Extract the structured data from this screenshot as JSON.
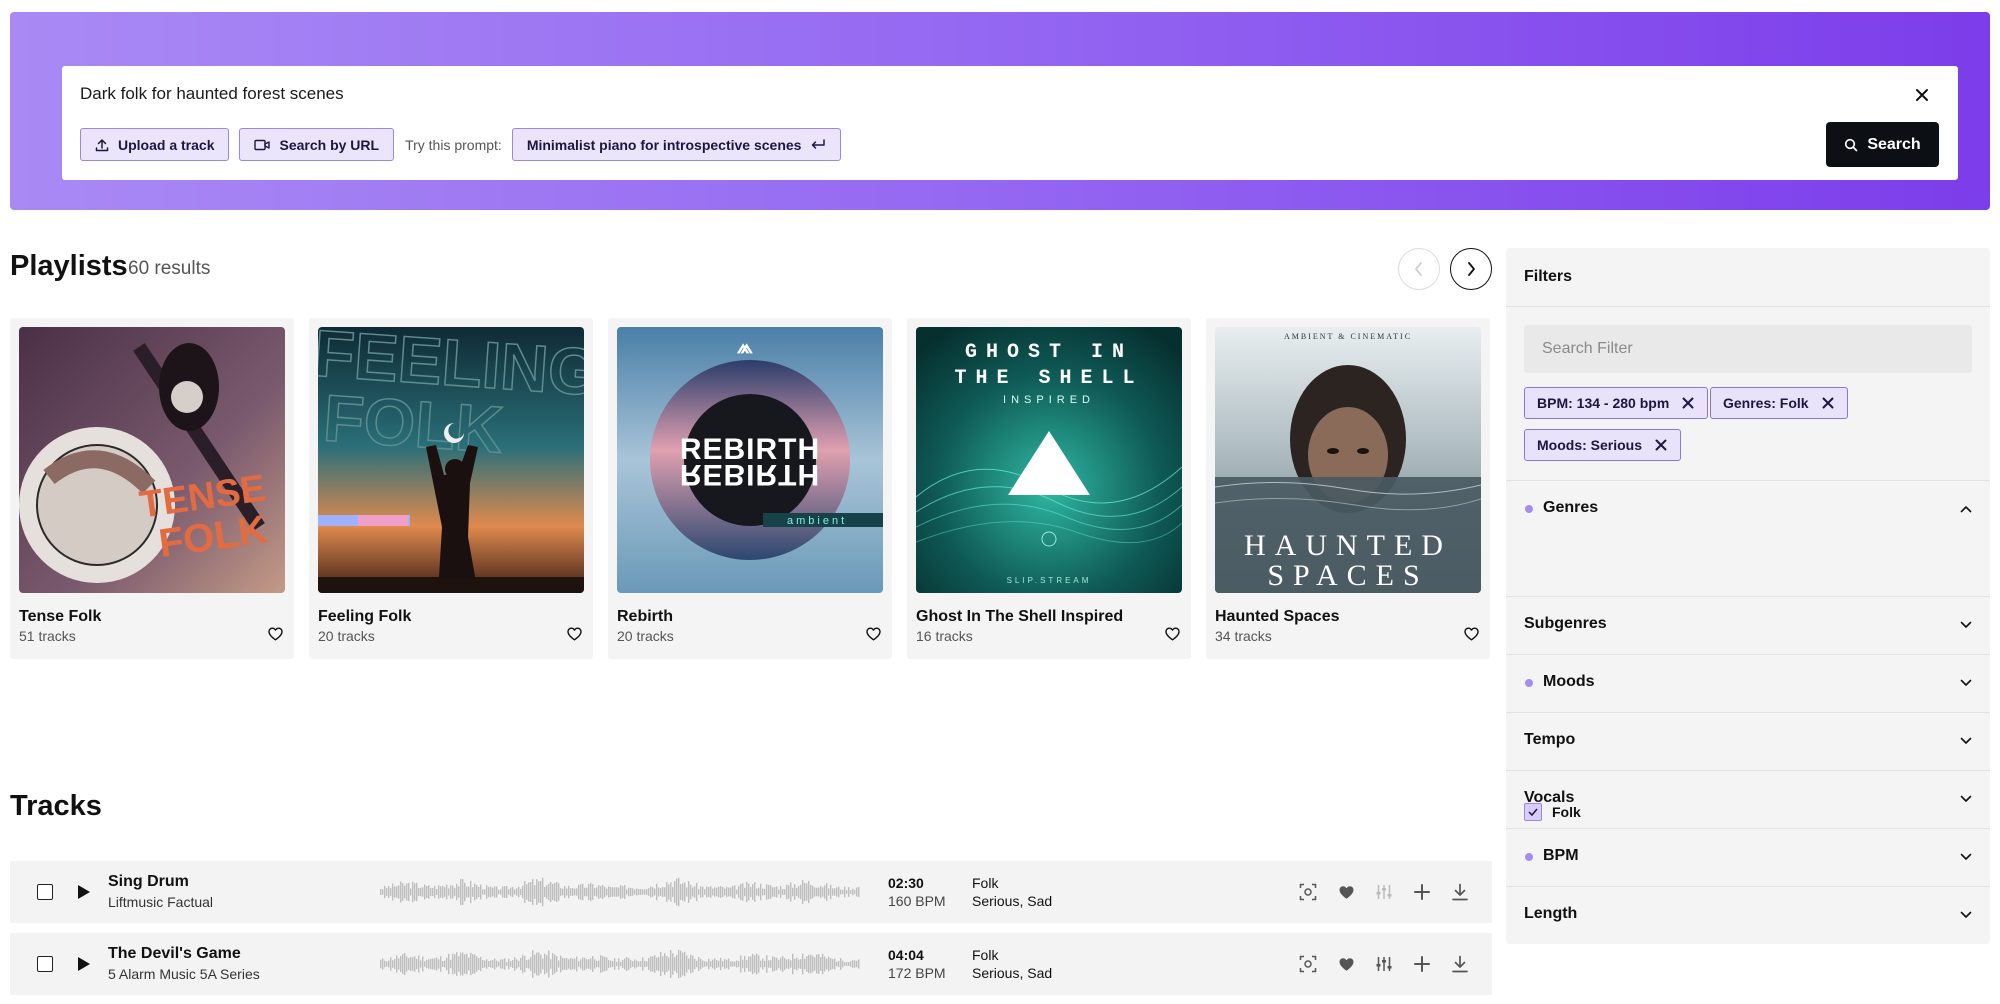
{
  "search": {
    "query": "Dark folk for haunted forest scenes",
    "upload_label": "Upload a track",
    "url_label": "Search by URL",
    "try_label": "Try this prompt:",
    "prompt_suggestion": "Minimalist piano for introspective scenes",
    "search_label": "Search"
  },
  "playlists": {
    "title": "Playlists",
    "count": "60 results",
    "items": [
      {
        "title": "Tense Folk",
        "tracks": "51 tracks",
        "cover_text": [
          "TENSE",
          "FOLK"
        ]
      },
      {
        "title": "Feeling Folk",
        "tracks": "20 tracks",
        "cover_text": [
          "FEELING",
          "FOLK"
        ]
      },
      {
        "title": "Rebirth",
        "tracks": "20 tracks",
        "cover_text": [
          "REBIRTH",
          "REBIRTH",
          "ambient"
        ]
      },
      {
        "title": "Ghost In The Shell Inspired",
        "tracks": "16 tracks",
        "cover_text": [
          "GHOST IN",
          "THE SHELL",
          "INSPIRED",
          "SLIP.STREAM"
        ]
      },
      {
        "title": "Haunted Spaces",
        "tracks": "34 tracks",
        "cover_text": [
          "AMBIENT & CINEMATIC",
          "HAUNTED",
          "SPACES"
        ]
      }
    ]
  },
  "tracks": {
    "title": "Tracks",
    "items": [
      {
        "title": "Sing Drum",
        "artist": "Liftmusic Factual",
        "duration": "02:30",
        "bpm": "160 BPM",
        "genre": "Folk",
        "moods": "Serious, Sad"
      },
      {
        "title": "The Devil's Game",
        "artist": "5 Alarm Music 5A Series",
        "duration": "04:04",
        "bpm": "172 BPM",
        "genre": "Folk",
        "moods": "Serious, Sad"
      }
    ]
  },
  "filters": {
    "title": "Filters",
    "search_placeholder": "Search Filter",
    "active_tags": [
      "BPM: 134 - 280 bpm",
      "Genres: Folk",
      "Moods: Serious"
    ],
    "sections": [
      {
        "label": "Genres",
        "active": true,
        "expanded": true
      },
      {
        "label": "Subgenres",
        "active": false,
        "expanded": false
      },
      {
        "label": "Moods",
        "active": true,
        "expanded": false
      },
      {
        "label": "Tempo",
        "active": false,
        "expanded": false
      },
      {
        "label": "Vocals",
        "active": false,
        "expanded": false
      },
      {
        "label": "BPM",
        "active": true,
        "expanded": false
      },
      {
        "label": "Length",
        "active": false,
        "expanded": false
      }
    ],
    "genre_option": "Folk"
  },
  "colors": {
    "accent": "#8f5cf1",
    "tag_bg": "#e8e2fb",
    "search_button": "#0c1014"
  }
}
